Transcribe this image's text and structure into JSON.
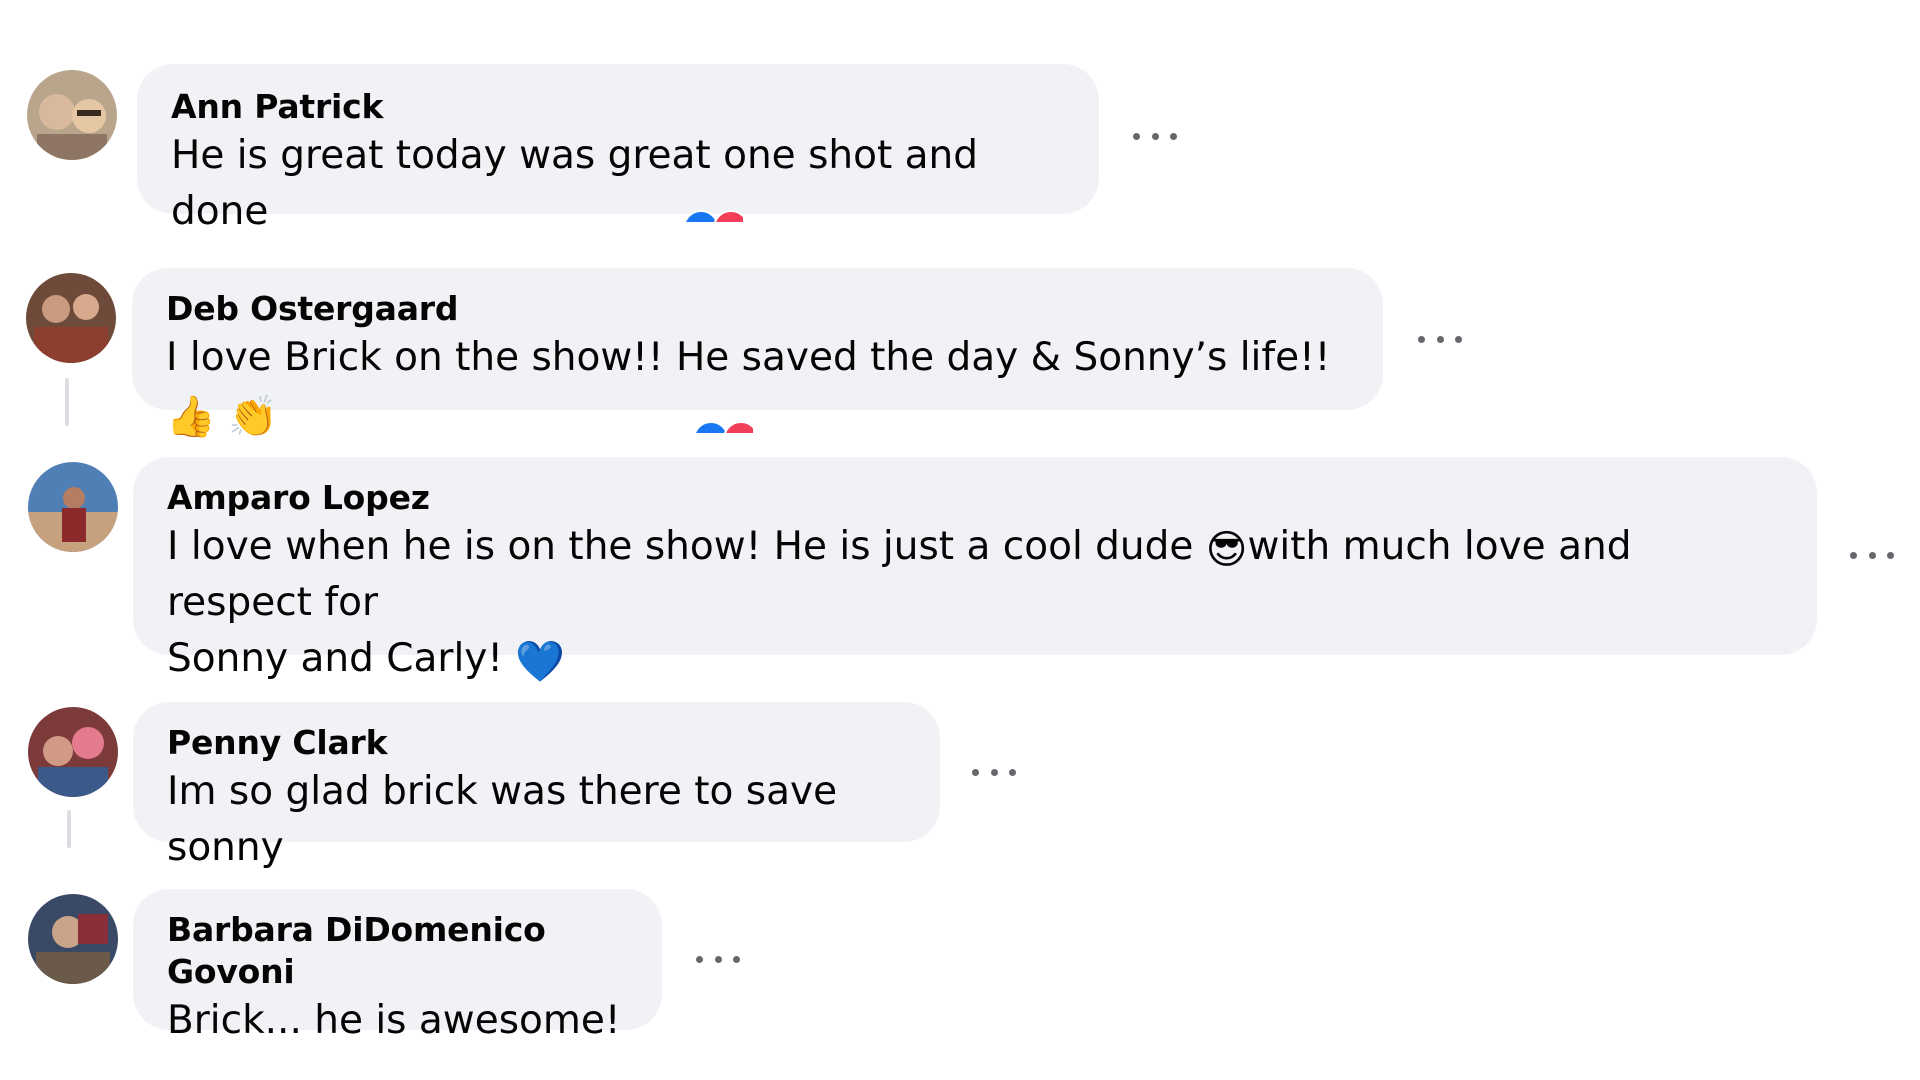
{
  "comments": [
    {
      "author": "Ann Patrick",
      "text": "He is great today was great one shot and done",
      "reactions": [
        "like",
        "love"
      ]
    },
    {
      "author": "Deb Ostergaard",
      "text_before": "I love Brick on the show!! He saved the day & Sonny’s life!! ",
      "emojis": [
        "👍",
        "👏"
      ],
      "reactions": [
        "like",
        "love"
      ]
    },
    {
      "author": "Amparo Lopez",
      "text_line1_before": "I love when he is on the show! He is just a cool dude ",
      "emoji_sunglasses": "😎",
      "text_line1_after": "with much love and respect for",
      "text_line2": "Sonny and Carly! ",
      "emoji_heart": "💙"
    },
    {
      "author": "Penny Clark",
      "text": "Im so glad brick was there to save sonny"
    },
    {
      "author": "Barbara DiDomenico Govoni",
      "text": "Brick... he is awesome!"
    }
  ],
  "icons": {
    "more_options": "more-options-icon",
    "reaction_like": "like-reaction-icon",
    "reaction_love": "love-reaction-icon"
  },
  "colors": {
    "bubble": "#f0f2f5",
    "text": "#050505",
    "secondary": "#65676b",
    "like": "#1877f2",
    "love": "#f33e58",
    "thread_line": "#dadde1"
  }
}
